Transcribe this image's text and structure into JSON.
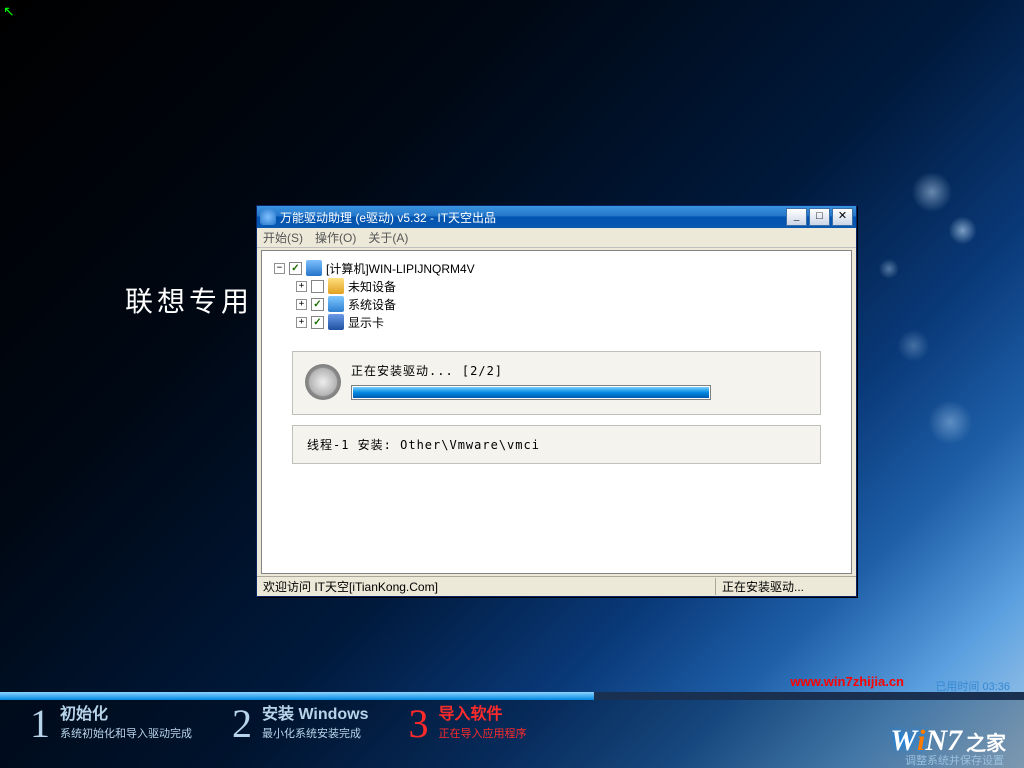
{
  "background_text": "联想专用  G",
  "window": {
    "title": "万能驱动助理 (e驱动) v5.32 - IT天空出品",
    "menu": {
      "start": "开始(S)",
      "operate": "操作(O)",
      "about": "关于(A)"
    },
    "tree": {
      "root": "[计算机]WIN-LIPIJNQRM4V",
      "unknown": "未知设备",
      "system": "系统设备",
      "display": "显示卡"
    },
    "progress_label": "正在安装驱动...  [2/2]",
    "thread_label": "线程-1 安装:  Other\\Vmware\\vmci",
    "status_left": "欢迎访问 IT天空[iTianKong.Com]",
    "status_right": "正在安装驱动..."
  },
  "footer": {
    "elapsed": "已用时间  03:36",
    "url": "www.win7zhijia.cn",
    "progress_percent": 58,
    "steps": [
      {
        "num": "1",
        "title": "初始化",
        "sub": "系统初始化和导入驱动完成"
      },
      {
        "num": "2",
        "title": "安装 Windows",
        "sub": "最小化系统安装完成"
      },
      {
        "num": "3",
        "title": "导入软件",
        "sub": "正在导入应用程序"
      }
    ],
    "logo_sub_text": "调整系统并保存设置"
  }
}
